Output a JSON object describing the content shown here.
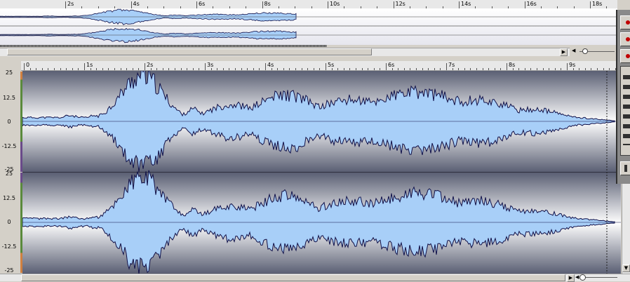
{
  "overview": {
    "ruler_labels": [
      "2s",
      "4s",
      "6s",
      "8s",
      "10s",
      "12s",
      "14s",
      "16s",
      "18s"
    ]
  },
  "main": {
    "ruler_labels": [
      "0",
      "1s",
      "2s",
      "3s",
      "4s",
      "5s",
      "6s",
      "7s",
      "8s",
      "9s"
    ],
    "channels": [
      {
        "y_labels": [
          "25",
          "12.5",
          "0",
          "-12.5",
          "-25"
        ]
      },
      {
        "y_labels": [
          "25",
          "12.5",
          "0",
          "-12.5",
          "-25"
        ]
      }
    ]
  },
  "colors": {
    "waveform_fill": "#a8cff8",
    "waveform_stroke": "#101048",
    "panel_bg_top": "#5a5f73",
    "panel_bg_mid": "#ffffff",
    "window_bg": "#d4d0c8"
  },
  "icons": {
    "scroll_right": "▶",
    "scroll_left": "◀",
    "scroll_down": "▼",
    "scroll_up": "▲"
  }
}
